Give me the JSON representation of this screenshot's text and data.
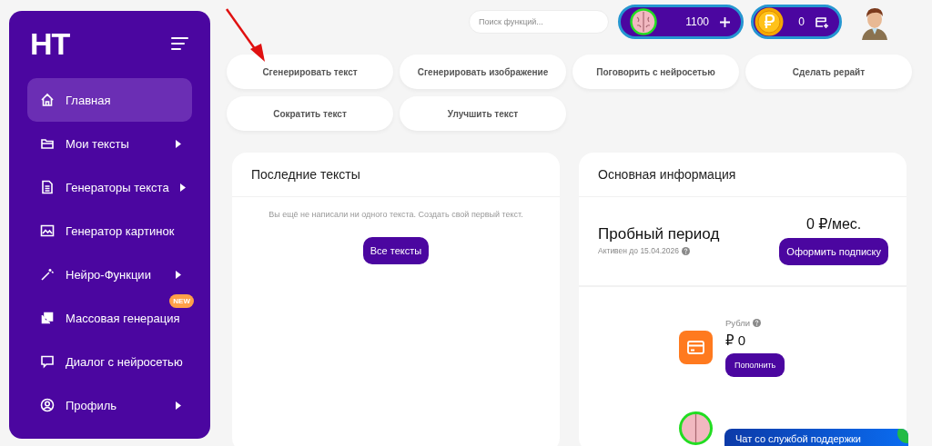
{
  "sidebar": {
    "logo": "НТ",
    "items": [
      {
        "kind": "home",
        "label": "Главная",
        "selected": true,
        "expandable": false
      },
      {
        "kind": "folder",
        "label": "Мои тексты",
        "selected": false,
        "expandable": true
      },
      {
        "kind": "document",
        "label": "Генераторы текста",
        "selected": false,
        "expandable": true
      },
      {
        "kind": "image",
        "label": "Генератор картинок",
        "selected": false,
        "expandable": false
      },
      {
        "kind": "wand",
        "label": "Нейро-Функции",
        "selected": false,
        "expandable": true
      },
      {
        "kind": "stack",
        "label": "Массовая генерация",
        "selected": false,
        "expandable": false,
        "badge": "NEW"
      },
      {
        "kind": "chat",
        "label": "Диалог с нейросетью",
        "selected": false,
        "expandable": false
      },
      {
        "kind": "user",
        "label": "Профиль",
        "selected": false,
        "expandable": true
      }
    ]
  },
  "header": {
    "search": {
      "placeholder": "Поиск функций..."
    },
    "balances": [
      {
        "kind": "neurons",
        "amount": "1100"
      },
      {
        "kind": "rubles",
        "amount": "0"
      }
    ]
  },
  "quick_actions": [
    "Сгенерировать текст",
    "Сгенерировать изображение",
    "Поговорить с нейросетью",
    "Сделать рерайт",
    "Сократить текст",
    "Улучшить текст"
  ],
  "recent_texts": {
    "title": "Последние тексты",
    "empty_message": "Вы ещё не написали ни одного текста. Создать свой первый текст.",
    "button": "Все тексты"
  },
  "main_info": {
    "title": "Основная информация",
    "plan_name": "Пробный период",
    "active_until": "Активен до 15.04.2026",
    "price": "0 ₽/мес.",
    "subscribe_button": "Оформить подписку",
    "balance": {
      "label": "Рубли",
      "amount": "₽ 0",
      "button": "Пополнить"
    }
  },
  "support_chat": {
    "title": "Чат со службой поддержки"
  }
}
